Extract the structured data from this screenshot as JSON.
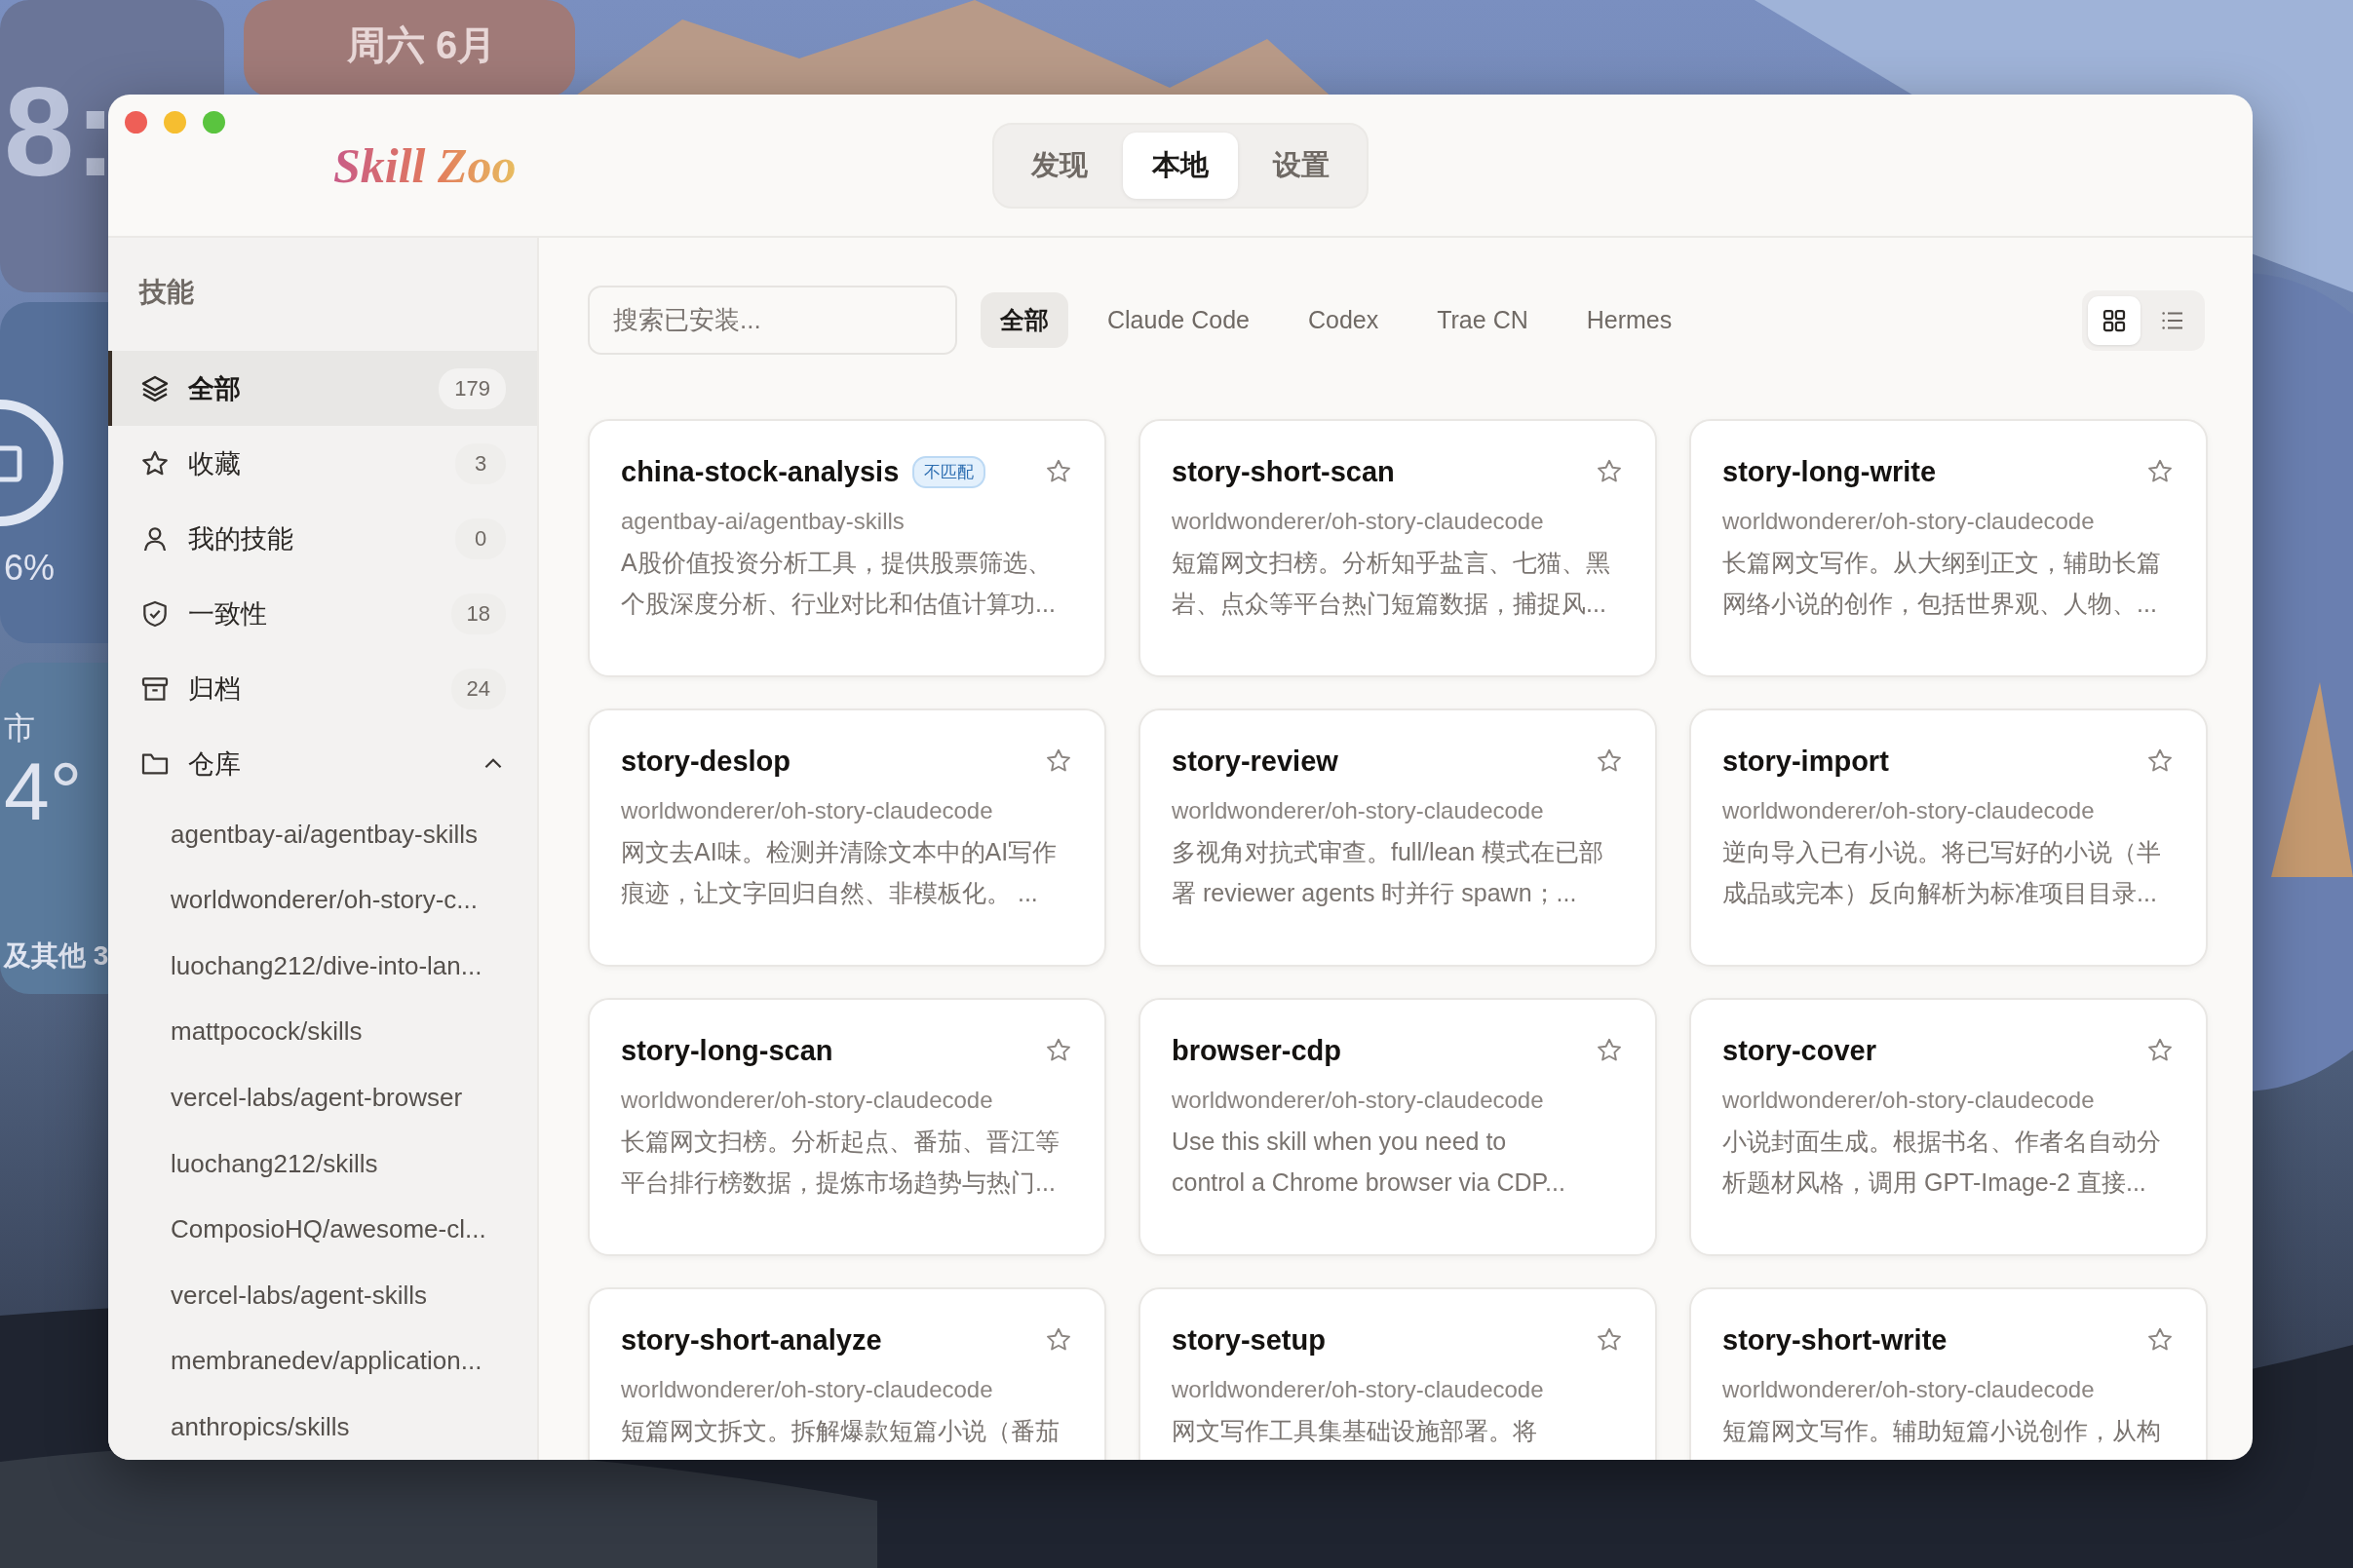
{
  "desktop": {
    "widgets": [
      {
        "kind": "clock",
        "text": "8:"
      },
      {
        "kind": "date",
        "text": "周六 6月"
      },
      {
        "kind": "battery",
        "text": "6%"
      },
      {
        "kind": "weather",
        "city": "市",
        "temp": "4°",
        "footer": "及其他 3"
      }
    ]
  },
  "window": {
    "app_name": "Skill Zoo",
    "tabs": [
      {
        "label": "发现",
        "selected": false
      },
      {
        "label": "本地",
        "selected": true
      },
      {
        "label": "设置",
        "selected": false
      }
    ]
  },
  "sidebar": {
    "heading": "技能",
    "items": [
      {
        "kind": "layers",
        "label": "全部",
        "count": "179",
        "selected": true
      },
      {
        "kind": "star",
        "label": "收藏",
        "count": "3",
        "selected": false
      },
      {
        "kind": "user",
        "label": "我的技能",
        "count": "0",
        "selected": false
      },
      {
        "kind": "shield",
        "label": "一致性",
        "count": "18",
        "selected": false
      },
      {
        "kind": "archive",
        "label": "归档",
        "count": "24",
        "selected": false
      }
    ],
    "repositories": {
      "label": "仓库",
      "expanded": true,
      "children": [
        {
          "label": "agentbay-ai/agentbay-skills"
        },
        {
          "label": "worldwonderer/oh-story-c..."
        },
        {
          "label": "luochang212/dive-into-lan..."
        },
        {
          "label": "mattpocock/skills"
        },
        {
          "label": "vercel-labs/agent-browser"
        },
        {
          "label": "luochang212/skills"
        },
        {
          "label": "ComposioHQ/awesome-cl..."
        },
        {
          "label": "vercel-labs/agent-skills"
        },
        {
          "label": "membranedev/application..."
        },
        {
          "label": "anthropics/skills"
        }
      ]
    }
  },
  "toolbar": {
    "search": {
      "placeholder": "搜索已安装..."
    },
    "filters": [
      {
        "label": "全部",
        "selected": true
      },
      {
        "label": "Claude Code",
        "selected": false
      },
      {
        "label": "Codex",
        "selected": false
      },
      {
        "label": "Trae CN",
        "selected": false
      },
      {
        "label": "Hermes",
        "selected": false
      }
    ],
    "view_modes": [
      {
        "kind": "grid",
        "selected": true
      },
      {
        "kind": "list",
        "selected": false
      }
    ]
  },
  "cards": [
    {
      "title": "china-stock-analysis",
      "badge": "不匹配",
      "starred": false,
      "repo": "agentbay-ai/agentbay-skills",
      "description": [
        "A股价值投资分析工具，提供股票筛选、",
        "个股深度分析、行业对比和估值计算功..."
      ]
    },
    {
      "title": "story-short-scan",
      "starred": false,
      "repo": "worldwonderer/oh-story-claudecode",
      "description": [
        "短篇网文扫榜。分析知乎盐言、七猫、黑",
        "岩、点众等平台热门短篇数据，捕捉风..."
      ]
    },
    {
      "title": "story-long-write",
      "starred": false,
      "repo": "worldwonderer/oh-story-claudecode",
      "description": [
        "长篇网文写作。从大纲到正文，辅助长篇",
        "网络小说的创作，包括世界观、人物、..."
      ]
    },
    {
      "title": "story-deslop",
      "starred": false,
      "repo": "worldwonderer/oh-story-claudecode",
      "description": [
        "网文去AI味。检测并清除文本中的AI写作",
        "痕迹，让文字回归自然、非模板化。 ..."
      ]
    },
    {
      "title": "story-review",
      "starred": false,
      "repo": "worldwonderer/oh-story-claudecode",
      "description": [
        "多视角对抗式审查。full/lean 模式在已部",
        "署 reviewer agents 时并行 spawn；..."
      ]
    },
    {
      "title": "story-import",
      "starred": false,
      "repo": "worldwonderer/oh-story-claudecode",
      "description": [
        "逆向导入已有小说。将已写好的小说（半",
        "成品或完本）反向解析为标准项目目录..."
      ]
    },
    {
      "title": "story-long-scan",
      "starred": false,
      "repo": "worldwonderer/oh-story-claudecode",
      "description": [
        "长篇网文扫榜。分析起点、番茄、晋江等",
        "平台排行榜数据，提炼市场趋势与热门..."
      ]
    },
    {
      "title": "browser-cdp",
      "starred": false,
      "repo": "worldwonderer/oh-story-claudecode",
      "description": [
        "Use this skill when you need to",
        "control a Chrome browser via CDP..."
      ]
    },
    {
      "title": "story-cover",
      "starred": false,
      "repo": "worldwonderer/oh-story-claudecode",
      "description": [
        "小说封面生成。根据书名、作者名自动分",
        "析题材风格，调用 GPT-Image-2 直接..."
      ]
    },
    {
      "title": "story-short-analyze",
      "starred": false,
      "repo": "worldwonderer/oh-story-claudecode",
      "description": [
        "短篇网文拆文。拆解爆款短篇小说（番茄"
      ]
    },
    {
      "title": "story-setup",
      "starred": false,
      "repo": "worldwonderer/oh-story-claudecode",
      "description": [
        "网文写作工具集基础设施部署。将"
      ]
    },
    {
      "title": "story-short-write",
      "starred": false,
      "repo": "worldwonderer/oh-story-claudecode",
      "description": [
        "短篇网文写作。辅助短篇小说创作，从构"
      ]
    }
  ]
}
